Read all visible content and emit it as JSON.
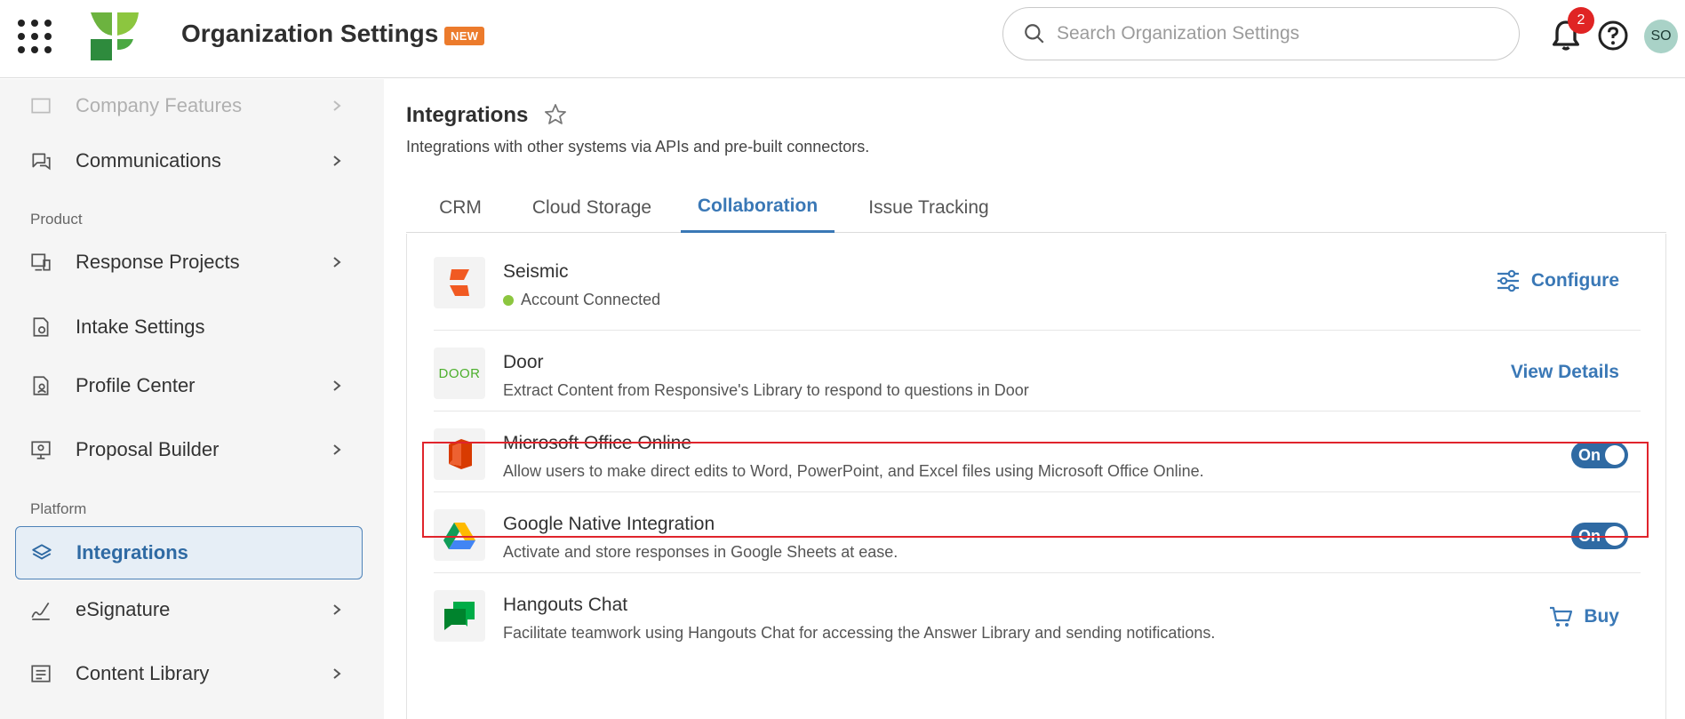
{
  "header": {
    "title": "Organization Settings",
    "badge": "NEW",
    "search_placeholder": "Search Organization Settings",
    "notification_count": "2",
    "avatar_initials": "SO"
  },
  "sidebar": {
    "items_top": [
      {
        "label": "Company Features",
        "icon": "company-features-icon"
      },
      {
        "label": "Communications",
        "icon": "chat-icon"
      }
    ],
    "product_section": "Product",
    "product_items": [
      {
        "label": "Response Projects",
        "icon": "projects-icon"
      },
      {
        "label": "Intake Settings",
        "icon": "intake-settings-icon"
      },
      {
        "label": "Profile Center",
        "icon": "profile-center-icon"
      },
      {
        "label": "Proposal Builder",
        "icon": "proposal-builder-icon"
      }
    ],
    "platform_section": "Platform",
    "platform_items": [
      {
        "label": "Integrations",
        "icon": "layers-icon",
        "active": true
      },
      {
        "label": "eSignature",
        "icon": "signature-icon"
      },
      {
        "label": "Content Library",
        "icon": "library-icon"
      }
    ]
  },
  "main": {
    "title": "Integrations",
    "subtitle": "Integrations with other systems via APIs and pre-built connectors.",
    "tabs": [
      {
        "label": "CRM"
      },
      {
        "label": "Cloud Storage"
      },
      {
        "label": "Collaboration",
        "active": true
      },
      {
        "label": "Issue Tracking"
      }
    ],
    "integrations": [
      {
        "name": "Seismic",
        "status": "Account Connected",
        "action": "Configure"
      },
      {
        "name": "Door",
        "logo_text": "DOOR",
        "description": "Extract Content from Responsive's Library to respond to questions in Door",
        "action": "View Details"
      },
      {
        "name": "Microsoft Office Online",
        "description": "Allow users to make direct edits to Word, PowerPoint, and Excel files using Microsoft Office Online.",
        "toggle": "On"
      },
      {
        "name": "Google Native Integration",
        "description": "Activate and store responses in Google Sheets at ease.",
        "toggle": "On"
      },
      {
        "name": "Hangouts Chat",
        "description": "Facilitate teamwork using Hangouts Chat for accessing the Answer Library and sending notifications.",
        "action": "Buy"
      }
    ]
  },
  "colors": {
    "accent": "#3a78b6",
    "toggle_on": "#2f6aa3",
    "new_badge": "#ec7b2c",
    "highlight": "#e0242c",
    "status_connected": "#8cc63f"
  }
}
